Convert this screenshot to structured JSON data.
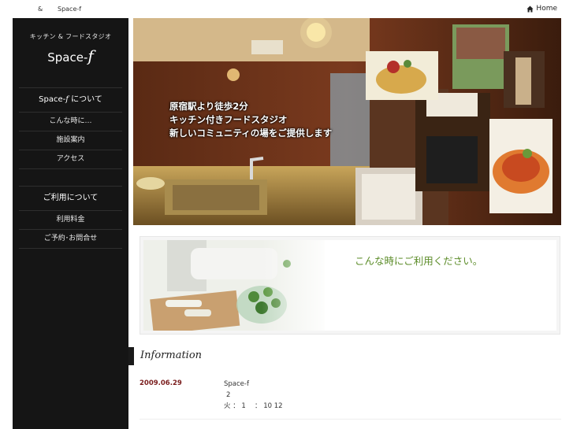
{
  "topbar": {
    "amp": "&",
    "brand": "Space-f",
    "home_label": "Home",
    "home_icon": "house-icon"
  },
  "sidebar": {
    "tagline": "キッチン & フードスタジオ",
    "logo_text": "Space-",
    "logo_f": "f",
    "menu1": {
      "head_prefix": "Space-",
      "head_f": "f",
      "head_suffix": " について",
      "items": [
        "こんな時に…",
        "施設案内",
        "アクセス"
      ]
    },
    "menu2": {
      "head": "ご利用について",
      "items": [
        "利用料金",
        "ご予約･お問合せ"
      ]
    }
  },
  "hero": {
    "line1": "原宿駅より徒歩2分",
    "line2": "キッチン付きフードスタジオ",
    "line3": "新しいコミュニティの場をご提供します"
  },
  "banner": {
    "title": "こんな時にご利用ください。"
  },
  "information": {
    "title": "Information",
    "date": "2009.06.29",
    "line1": "Space-f",
    "line2": "2",
    "line3": "火 ： 1　 ： 10 12"
  }
}
